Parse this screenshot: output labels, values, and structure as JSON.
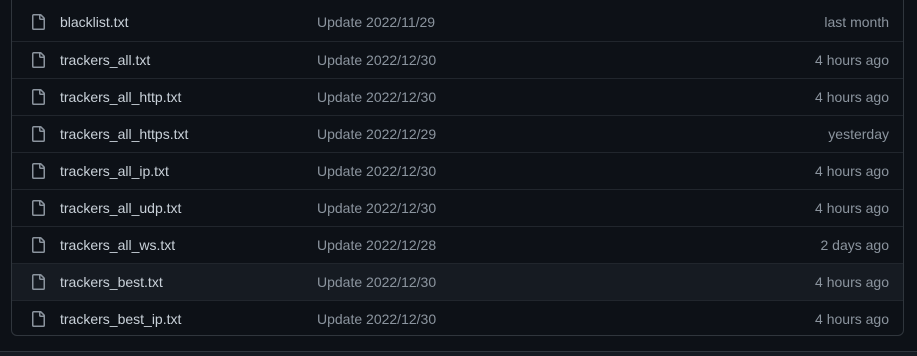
{
  "files": [
    {
      "name": "blacklist.txt",
      "message": "Update 2022/11/29",
      "age": "last month",
      "icon": "file-icon"
    },
    {
      "name": "trackers_all.txt",
      "message": "Update 2022/12/30",
      "age": "4 hours ago",
      "icon": "file-icon"
    },
    {
      "name": "trackers_all_http.txt",
      "message": "Update 2022/12/30",
      "age": "4 hours ago",
      "icon": "file-icon"
    },
    {
      "name": "trackers_all_https.txt",
      "message": "Update 2022/12/29",
      "age": "yesterday",
      "icon": "file-icon"
    },
    {
      "name": "trackers_all_ip.txt",
      "message": "Update 2022/12/30",
      "age": "4 hours ago",
      "icon": "file-icon"
    },
    {
      "name": "trackers_all_udp.txt",
      "message": "Update 2022/12/30",
      "age": "4 hours ago",
      "icon": "file-icon"
    },
    {
      "name": "trackers_all_ws.txt",
      "message": "Update 2022/12/28",
      "age": "2 days ago",
      "icon": "file-icon"
    },
    {
      "name": "trackers_best.txt",
      "message": "Update 2022/12/30",
      "age": "4 hours ago",
      "icon": "file-icon"
    },
    {
      "name": "trackers_best_ip.txt",
      "message": "Update 2022/12/30",
      "age": "4 hours ago",
      "icon": "file-icon"
    }
  ],
  "colors": {
    "background": "#0d1117",
    "row_hover": "#161b22",
    "border": "#30363d",
    "file_name": "#c9d1d9",
    "muted": "#8b949e"
  }
}
